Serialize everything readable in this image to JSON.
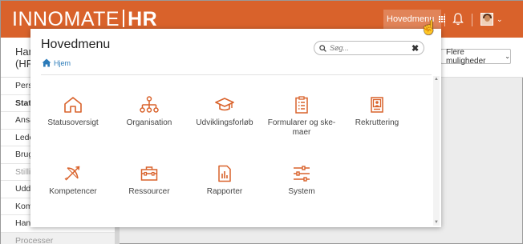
{
  "topbar": {
    "logo_left": "INNOMATE",
    "logo_right": "HR",
    "menu_label": "Hovedmenu"
  },
  "background": {
    "name_line1": "Han",
    "name_line2": "(HR",
    "more_button": "Flere muligheder",
    "nav_items": [
      "Pers",
      "Stat",
      "Ansa",
      "Lede",
      "Brug",
      "Stilli",
      "Udda",
      "Kom",
      "Hand",
      "Processer"
    ]
  },
  "panel": {
    "title": "Hovedmenu",
    "breadcrumb": "Hjem",
    "search_placeholder": "Søg...",
    "tiles": [
      {
        "label": "Statusoversigt",
        "icon": "home-icon"
      },
      {
        "label": "Organisation",
        "icon": "org-chart-icon"
      },
      {
        "label": "Udviklingsforløb",
        "icon": "graduation-cap-icon"
      },
      {
        "label": "Formularer og ske-maer",
        "line1": "Formularer og ske-",
        "line2": "maer",
        "icon": "clipboard-list-icon"
      },
      {
        "label": "Rekruttering",
        "icon": "id-card-icon"
      },
      {
        "label": "Kompetencer",
        "icon": "bow-arrow-icon"
      },
      {
        "label": "Ressourcer",
        "icon": "toolbox-icon"
      },
      {
        "label": "Rapporter",
        "icon": "report-chart-icon"
      },
      {
        "label": "System",
        "icon": "sliders-icon"
      }
    ]
  },
  "colors": {
    "brand": "#d9622b",
    "icon": "#d9622b",
    "link": "#2b7bb9"
  }
}
